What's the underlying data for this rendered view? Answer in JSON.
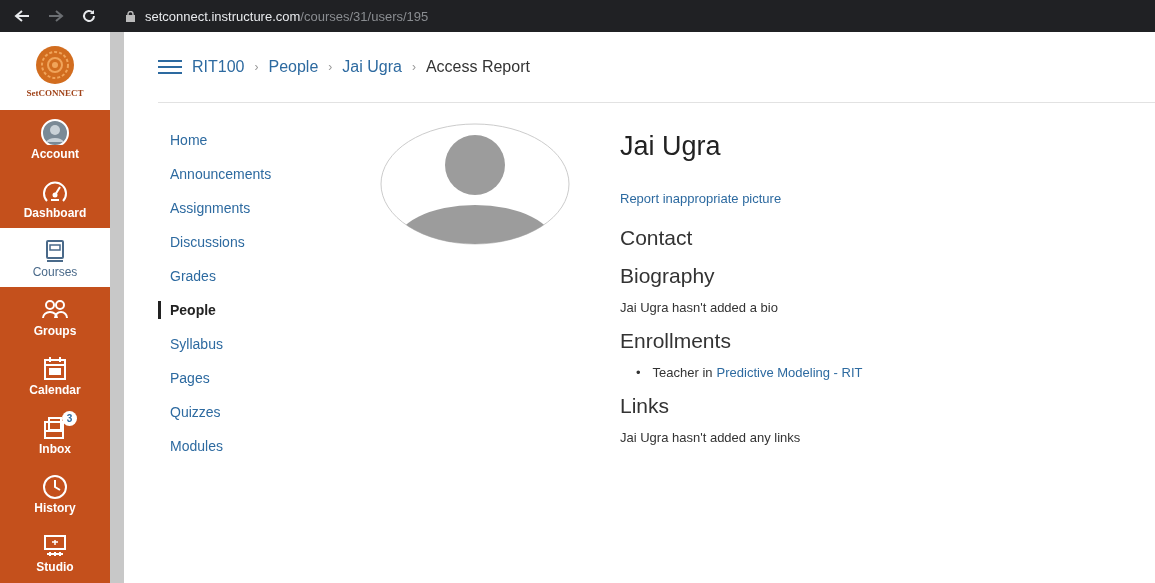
{
  "browser": {
    "url_host": "setconnect.instructure.com",
    "url_path": "/courses/31/users/195"
  },
  "global_nav": {
    "logo_text": "SetCONNECT",
    "items": [
      {
        "label": "Account",
        "selected": false
      },
      {
        "label": "Dashboard",
        "selected": false
      },
      {
        "label": "Courses",
        "selected": true
      },
      {
        "label": "Groups",
        "selected": false
      },
      {
        "label": "Calendar",
        "selected": false
      },
      {
        "label": "Inbox",
        "selected": false,
        "badge": "3"
      },
      {
        "label": "History",
        "selected": false
      },
      {
        "label": "Studio",
        "selected": false
      }
    ]
  },
  "breadcrumbs": [
    {
      "label": "RIT100",
      "link": true
    },
    {
      "separator": "›",
      "label": "People",
      "link": true
    },
    {
      "separator": "›",
      "label": "Jai Ugra",
      "link": true
    },
    {
      "separator": "›",
      "label": "Access Report",
      "link": false
    }
  ],
  "course_nav": [
    {
      "label": "Home",
      "selected": false
    },
    {
      "label": "Announcements",
      "selected": false
    },
    {
      "label": "Assignments",
      "selected": false
    },
    {
      "label": "Discussions",
      "selected": false
    },
    {
      "label": "Grades",
      "selected": false
    },
    {
      "label": "People",
      "selected": true
    },
    {
      "label": "Syllabus",
      "selected": false
    },
    {
      "label": "Pages",
      "selected": false
    },
    {
      "label": "Quizzes",
      "selected": false
    },
    {
      "label": "Modules",
      "selected": false
    }
  ],
  "profile": {
    "name": "Jai Ugra",
    "report_link": "Report inappropriate picture",
    "sections": [
      {
        "heading": "Contact"
      },
      {
        "heading": "Biography",
        "text": "Jai Ugra hasn't added a bio"
      },
      {
        "heading": "Enrollments",
        "enrollments": [
          {
            "bullet": "•",
            "text": "Teacher in",
            "link": "Predictive Modeling - RIT"
          }
        ]
      },
      {
        "heading": "Links",
        "text": "Jai Ugra hasn't added any links"
      }
    ]
  }
}
